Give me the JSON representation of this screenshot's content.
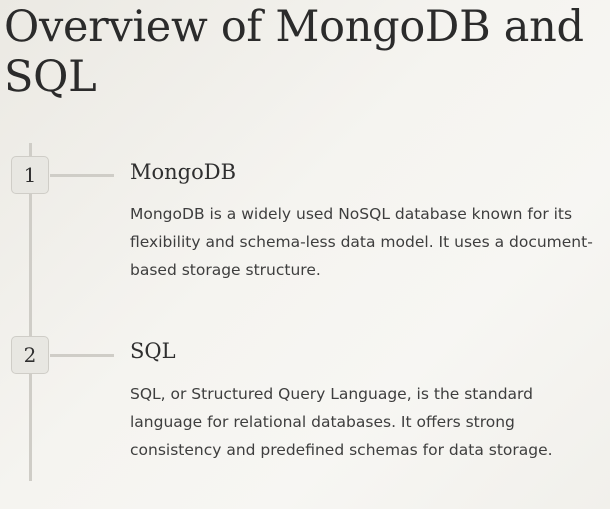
{
  "page": {
    "title": "Overview of MongoDB and SQL"
  },
  "items": [
    {
      "number": "1",
      "heading": "MongoDB",
      "description": "MongoDB is a widely used NoSQL database known for its flexibility and schema-less data model. It uses a document-based storage structure."
    },
    {
      "number": "2",
      "heading": "SQL",
      "description": "SQL, or Structured Query Language, is the standard language for relational databases. It offers strong consistency and predefined schemas for data storage."
    }
  ],
  "colors": {
    "timeline": "#cfcdc7",
    "badge_background": "#e8e7e2",
    "text": "#2f2f2f"
  }
}
